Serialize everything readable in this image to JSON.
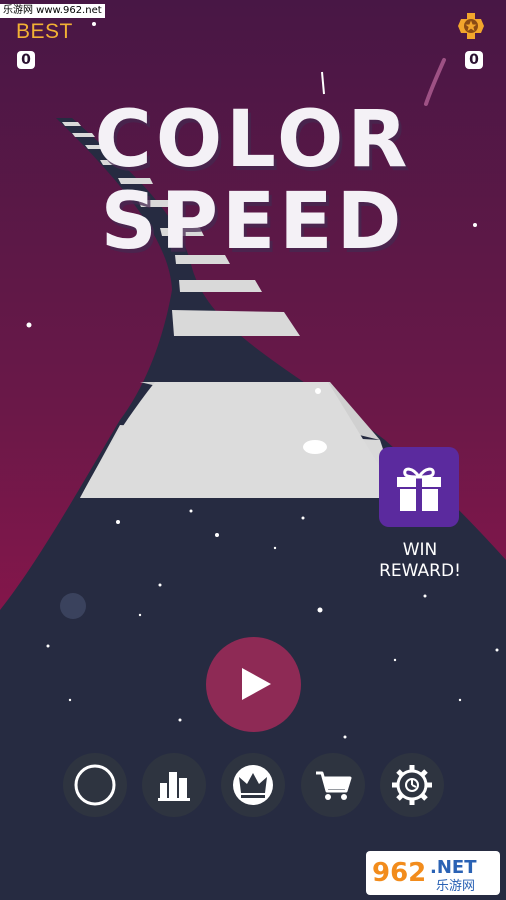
{
  "watermark_top": "乐游网 www.962.net",
  "header": {
    "best_label": "BEST",
    "best_score": "0",
    "coins": "0",
    "coin_icon": "gear-coin-icon"
  },
  "title": {
    "line1": "COLOR",
    "line2": "SPEED"
  },
  "reward": {
    "label_line1": "WIN",
    "label_line2": "REWARD!",
    "icon": "gift-icon"
  },
  "play": {
    "icon": "play-icon"
  },
  "bottom_bar": {
    "buttons": [
      {
        "icon": "circle-skin-icon"
      },
      {
        "icon": "leaderboard-icon"
      },
      {
        "icon": "crown-icon"
      },
      {
        "icon": "cart-icon"
      },
      {
        "icon": "settings-gear-icon"
      }
    ]
  },
  "watermark_bottom": {
    "brand": "962",
    "suffix": ".NET",
    "subtitle": "乐游网"
  },
  "colors": {
    "sky_top": "#4a1743",
    "sky_bottom": "#a5154f",
    "road_dark": "#262b41",
    "road_light": "#dcdcdc",
    "accent_orange": "#f2b134",
    "reward_purple": "#5b2a9e",
    "play_magenta": "#8e2a55"
  }
}
